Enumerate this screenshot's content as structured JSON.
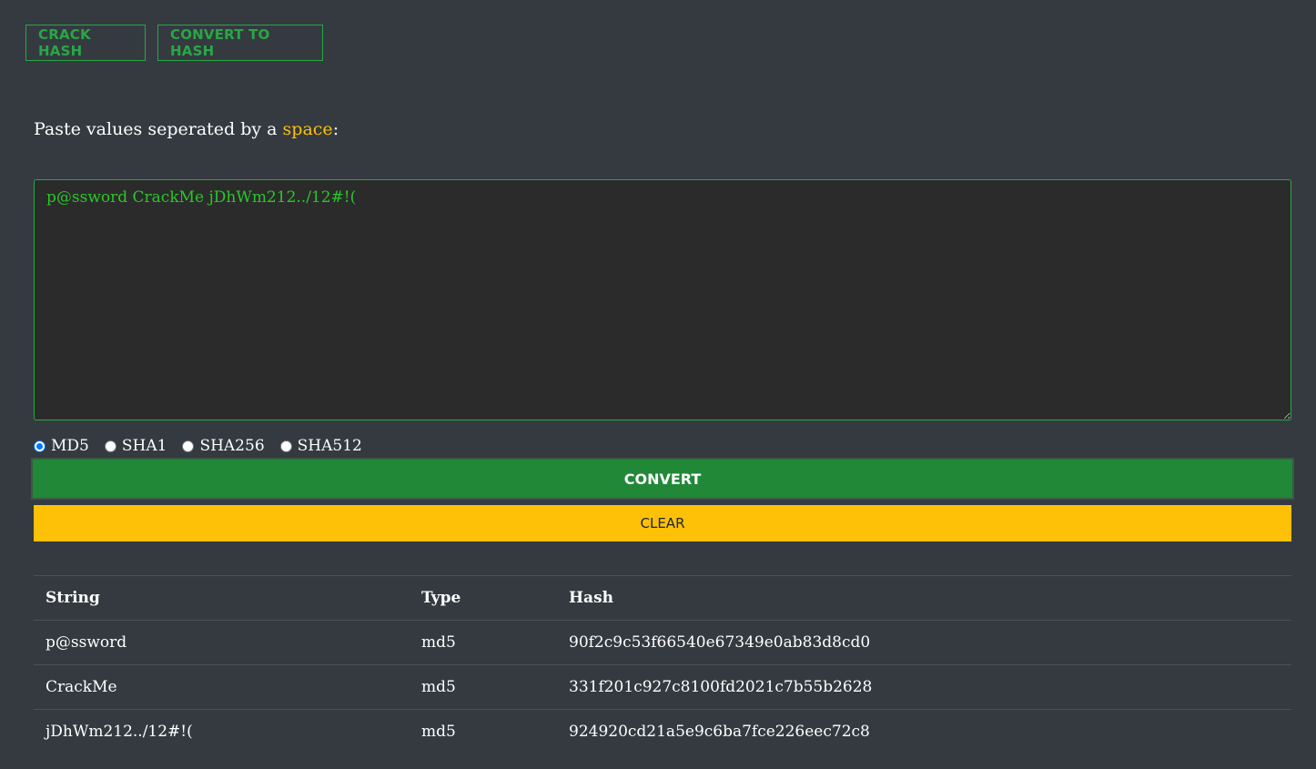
{
  "nav": {
    "crack_hash": "CRACK HASH",
    "convert_to_hash": "CONVERT TO HASH"
  },
  "prompt": {
    "prefix": "Paste values seperated by a ",
    "accent": "space",
    "suffix": ":"
  },
  "input": {
    "value": "p@ssword CrackMe jDhWm212../12#!("
  },
  "algorithms": {
    "selected": "MD5",
    "options": [
      "MD5",
      "SHA1",
      "SHA256",
      "SHA512"
    ]
  },
  "buttons": {
    "convert": "CONVERT",
    "clear": "CLEAR"
  },
  "table": {
    "headers": [
      "String",
      "Type",
      "Hash"
    ],
    "rows": [
      [
        "p@ssword",
        "md5",
        "90f2c9c53f66540e67349e0ab83d8cd0"
      ],
      [
        "CrackMe",
        "md5",
        "331f201c927c8100fd2021c7b55b2628"
      ],
      [
        "jDhWm212../12#!(",
        "md5",
        "924920cd21a5e9c6ba7fce226eec72c8"
      ]
    ]
  },
  "colors": {
    "background": "#343a40",
    "green": "#28a745",
    "yellow": "#ffc107"
  }
}
